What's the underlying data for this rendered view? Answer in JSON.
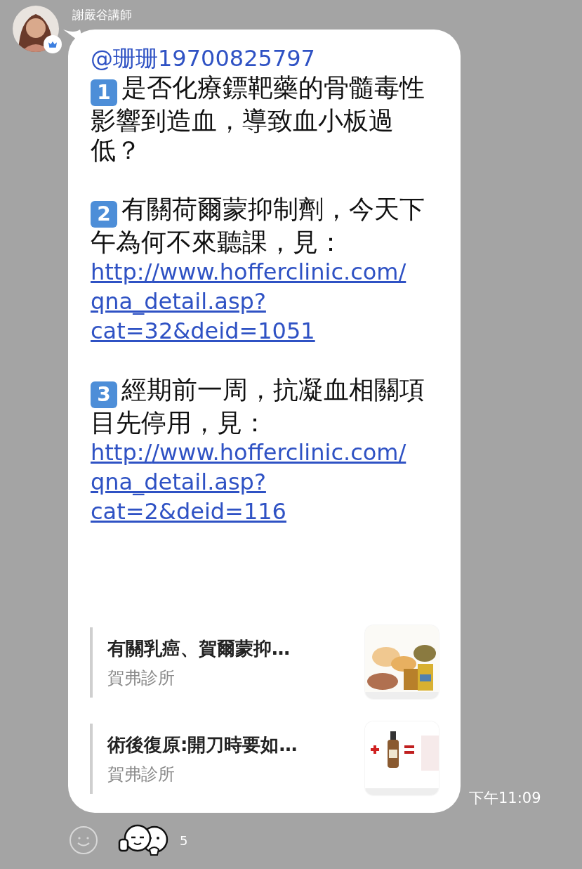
{
  "sender": {
    "name": "謝嚴谷講師"
  },
  "message": {
    "mention": "@珊珊19700825797",
    "items": [
      {
        "number": "1",
        "text": "是否化療鏢靶藥的骨髓毒性影響到造血，導致血小板過低？"
      },
      {
        "number": "2",
        "text": "有關荷爾蒙抑制劑，今天下午為何不來聽課，見：",
        "link": "http://www.hofferclinic.com/qna_detail.asp?cat=32&deid=1051"
      },
      {
        "number": "3",
        "text": "經期前一周，抗凝血相關項目先停用，見：",
        "link": "http://www.hofferclinic.com/qna_detail.asp?cat=2&deid=116"
      }
    ],
    "link_previews": [
      {
        "title": "有關乳癌、賀爾蒙抑…",
        "source": "賀弗診所"
      },
      {
        "title": "術後復原:開刀時要如…",
        "source": "賀弗診所"
      }
    ]
  },
  "time": "下午11:09",
  "reactions": {
    "count": "5"
  }
}
